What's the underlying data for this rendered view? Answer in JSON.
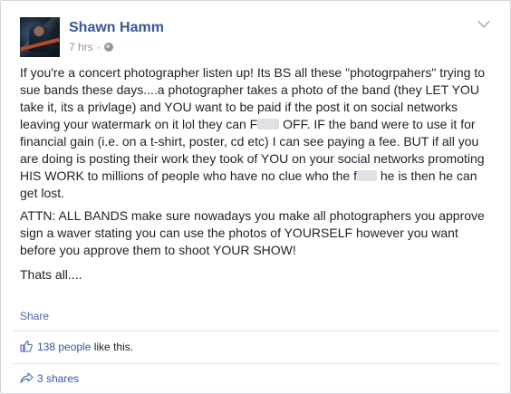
{
  "post": {
    "author": "Shawn Hamm",
    "time": "7 hrs",
    "separator": "·",
    "audience_icon": "globe-icon",
    "menu_icon": "chevron-down-icon",
    "paragraphs": {
      "p1": {
        "a": "If you're a concert photographer listen up! Its BS all these \"photogrpahers\" trying to sue bands these days....a photographer takes a photo of the band (they LET YOU take it, its a privlage) and YOU want to be paid if the post it on social networks leaving your watermark on it lol they can F",
        "b": " OFF. IF the band were to use it for financial gain (i.e. on a t-shirt, poster, cd etc) I can see paying a fee. BUT if all you are doing is posting their work they took of YOU on your social networks promoting HIS WORK to millions of people who have no clue who the f",
        "c": " he is then he can get lost."
      },
      "p2": "ATTN: ALL BANDS make sure nowadays you make all photographers you approve sign a waver stating you can use the photos of YOURSELF however you want before you approve them to shoot YOUR SHOW!",
      "p3": "Thats all...."
    },
    "share_label": "Share"
  },
  "stats": {
    "like_icon": "thumbs-up-icon",
    "likes_count": "138 people",
    "likes_suffix": " like this.",
    "share_icon": "share-arrow-icon",
    "shares": "3 shares"
  },
  "colors": {
    "link": "#365899",
    "text": "#1d2129",
    "meta": "#90949c"
  }
}
